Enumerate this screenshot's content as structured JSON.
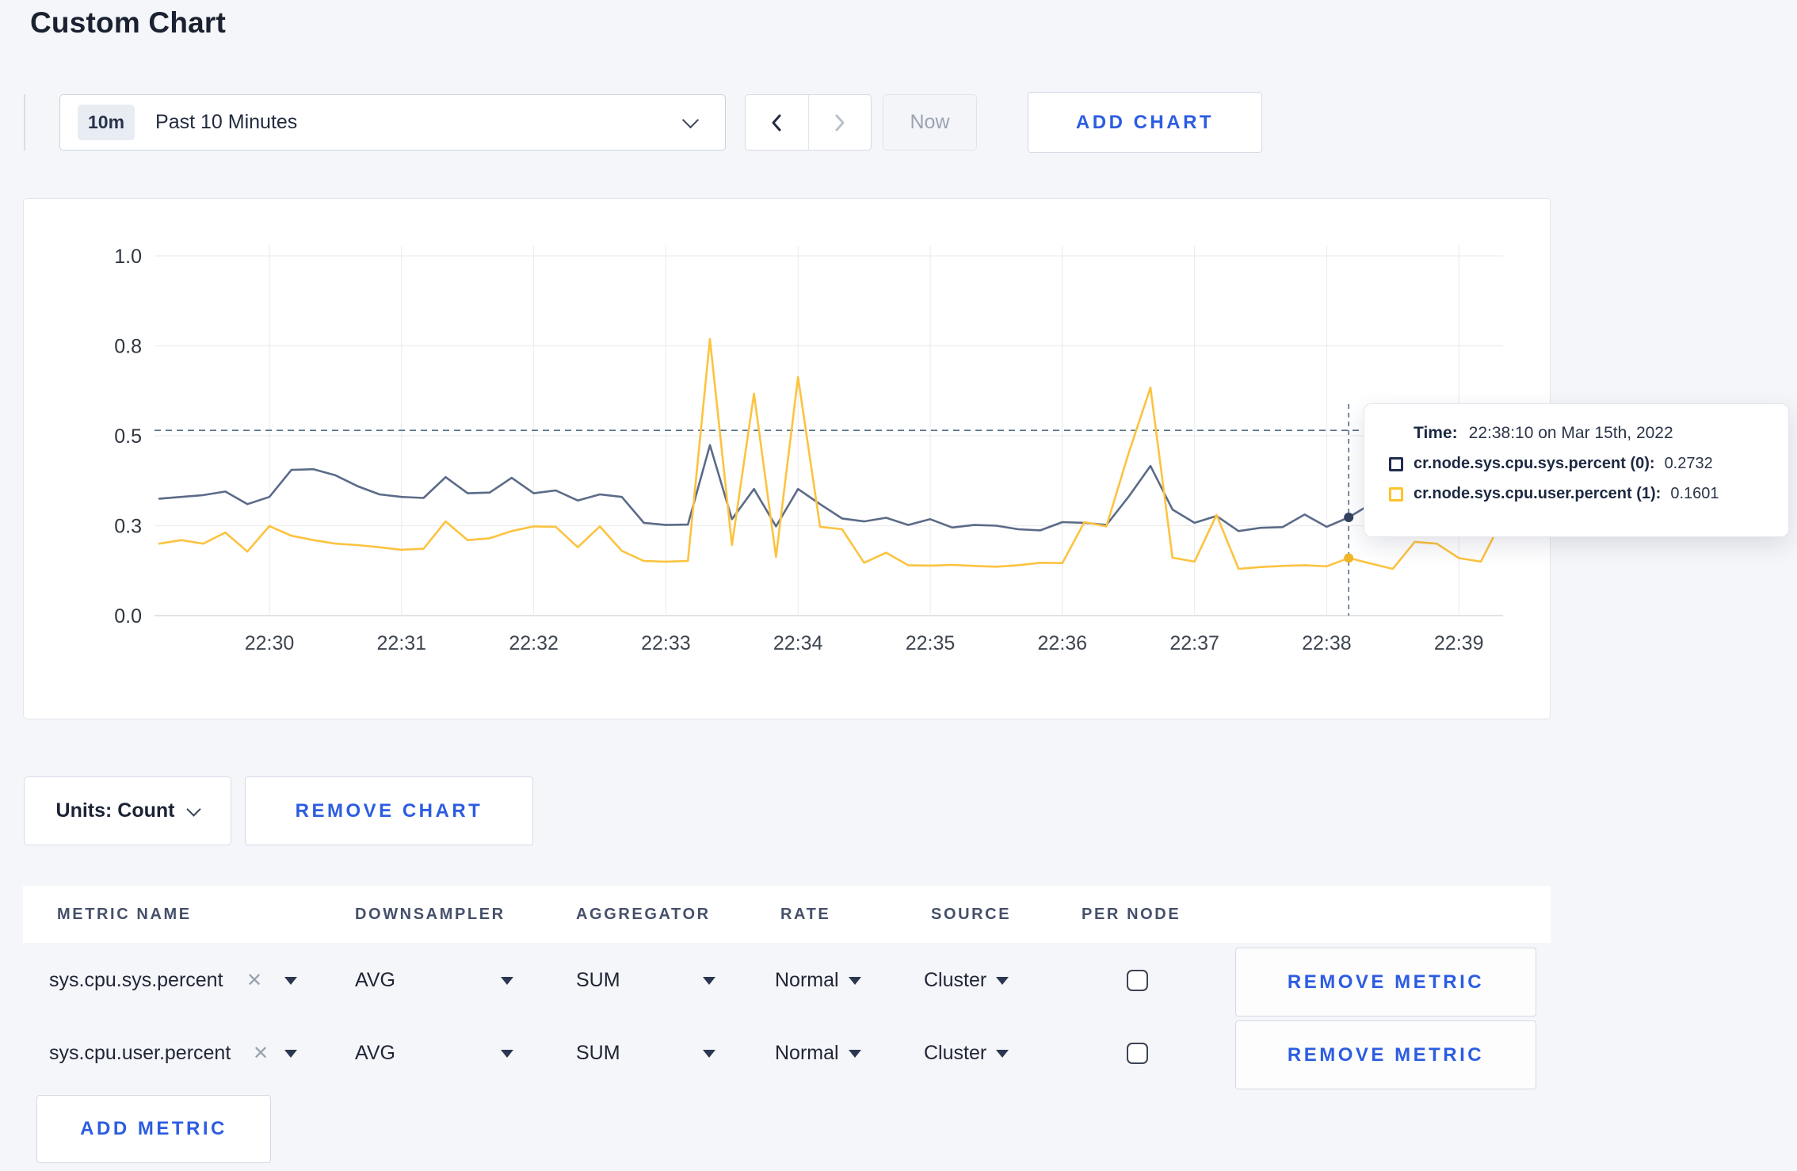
{
  "page": {
    "title": "Custom Chart"
  },
  "toolbar": {
    "time_window_badge": "10m",
    "time_window_label": "Past 10 Minutes",
    "now_label": "Now",
    "add_chart_label": "ADD CHART"
  },
  "chart_data": {
    "type": "line",
    "title": "",
    "xlabel": "",
    "ylabel": "",
    "x_axis": {
      "ticks": [
        "22:30",
        "22:31",
        "22:32",
        "22:33",
        "22:34",
        "22:35",
        "22:36",
        "22:37",
        "22:38",
        "22:39"
      ]
    },
    "y_axis": {
      "tick_labels": [
        "0.0",
        "0.3",
        "0.5",
        "0.8",
        "1.0"
      ],
      "tick_values": [
        0,
        0.25,
        0.5,
        0.75,
        1.0
      ],
      "range": [
        0,
        1
      ]
    },
    "grid": true,
    "legend_position": "tooltip",
    "start_time": "22:29:10",
    "interval_seconds": 10,
    "series": [
      {
        "name": "cr.node.sys.cpu.sys.percent",
        "color": "#5b6b88",
        "values": [
          0.325,
          0.33,
          0.335,
          0.345,
          0.31,
          0.33,
          0.405,
          0.407,
          0.39,
          0.36,
          0.337,
          0.33,
          0.327,
          0.385,
          0.34,
          0.342,
          0.383,
          0.34,
          0.348,
          0.32,
          0.337,
          0.33,
          0.258,
          0.252,
          0.253,
          0.474,
          0.268,
          0.352,
          0.248,
          0.352,
          0.31,
          0.27,
          0.262,
          0.272,
          0.252,
          0.268,
          0.245,
          0.252,
          0.25,
          0.24,
          0.237,
          0.26,
          0.258,
          0.252,
          0.33,
          0.416,
          0.295,
          0.258,
          0.277,
          0.235,
          0.244,
          0.246,
          0.281,
          0.247,
          0.2732,
          0.31,
          0.305,
          0.3,
          0.296,
          0.3,
          0.29,
          0.305
        ]
      },
      {
        "name": "cr.node.sys.cpu.user.percent",
        "color": "#fcc340",
        "values": [
          0.2,
          0.21,
          0.2,
          0.231,
          0.178,
          0.249,
          0.222,
          0.21,
          0.2,
          0.196,
          0.19,
          0.183,
          0.186,
          0.262,
          0.21,
          0.215,
          0.235,
          0.248,
          0.247,
          0.19,
          0.248,
          0.18,
          0.152,
          0.15,
          0.152,
          0.769,
          0.196,
          0.617,
          0.163,
          0.663,
          0.247,
          0.24,
          0.147,
          0.175,
          0.14,
          0.139,
          0.141,
          0.138,
          0.136,
          0.14,
          0.147,
          0.146,
          0.26,
          0.248,
          0.45,
          0.634,
          0.161,
          0.15,
          0.28,
          0.13,
          0.135,
          0.138,
          0.14,
          0.137,
          0.1601,
          0.145,
          0.13,
          0.205,
          0.2,
          0.16,
          0.15,
          0.27
        ]
      }
    ],
    "hover": {
      "time": "22:38:10",
      "index": 54,
      "sys_value": 0.2732,
      "user_value": 0.1601,
      "guide_value": 0.515
    }
  },
  "tooltip": {
    "time_label": "Time:",
    "time_value": "22:38:10 on Mar 15th, 2022",
    "rows": [
      {
        "name": "cr.node.sys.cpu.sys.percent (0):",
        "value": "0.2732",
        "color": "#1f2d4d"
      },
      {
        "name": "cr.node.sys.cpu.user.percent (1):",
        "value": "0.1601",
        "color": "#fdc428"
      }
    ]
  },
  "chart_footer": {
    "units_label": "Units: Count",
    "remove_chart_label": "REMOVE CHART"
  },
  "metrics_table": {
    "headers": [
      "METRIC NAME",
      "DOWNSAMPLER",
      "AGGREGATOR",
      "RATE",
      "SOURCE",
      "PER NODE"
    ],
    "rows": [
      {
        "metric": "sys.cpu.sys.percent",
        "downsampler": "AVG",
        "aggregator": "SUM",
        "rate": "Normal",
        "source": "Cluster",
        "per_node_checked": false,
        "remove_label": "REMOVE METRIC"
      },
      {
        "metric": "sys.cpu.user.percent",
        "downsampler": "AVG",
        "aggregator": "SUM",
        "rate": "Normal",
        "source": "Cluster",
        "per_node_checked": false,
        "remove_label": "REMOVE METRIC"
      }
    ],
    "add_metric_label": "ADD METRIC"
  },
  "colors": {
    "accent_blue": "#2c5ce1",
    "series_sys": "#5b6b88",
    "series_user": "#fcc340",
    "page_background": "#f5f6f9"
  }
}
